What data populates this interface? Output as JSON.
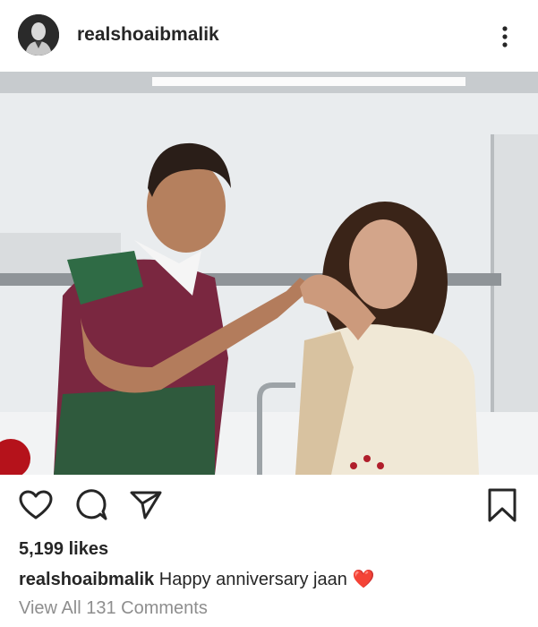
{
  "post": {
    "username": "realshoaibmalik",
    "likes_text": "5,199 likes",
    "caption": {
      "author": "realshoaibmalik",
      "text": "Happy anniversary jaan",
      "emoji": "❤️"
    },
    "view_comments_text": "View All 131 Comments"
  },
  "icons": {
    "more": "more-vertical-icon",
    "like": "heart-outline-icon",
    "comment": "comment-bubble-icon",
    "share": "send-paper-plane-icon",
    "save": "bookmark-outline-icon"
  },
  "colors": {
    "text": "#262626",
    "secondary_text": "#8e8e8e",
    "heart_emoji": "#e0202a"
  }
}
